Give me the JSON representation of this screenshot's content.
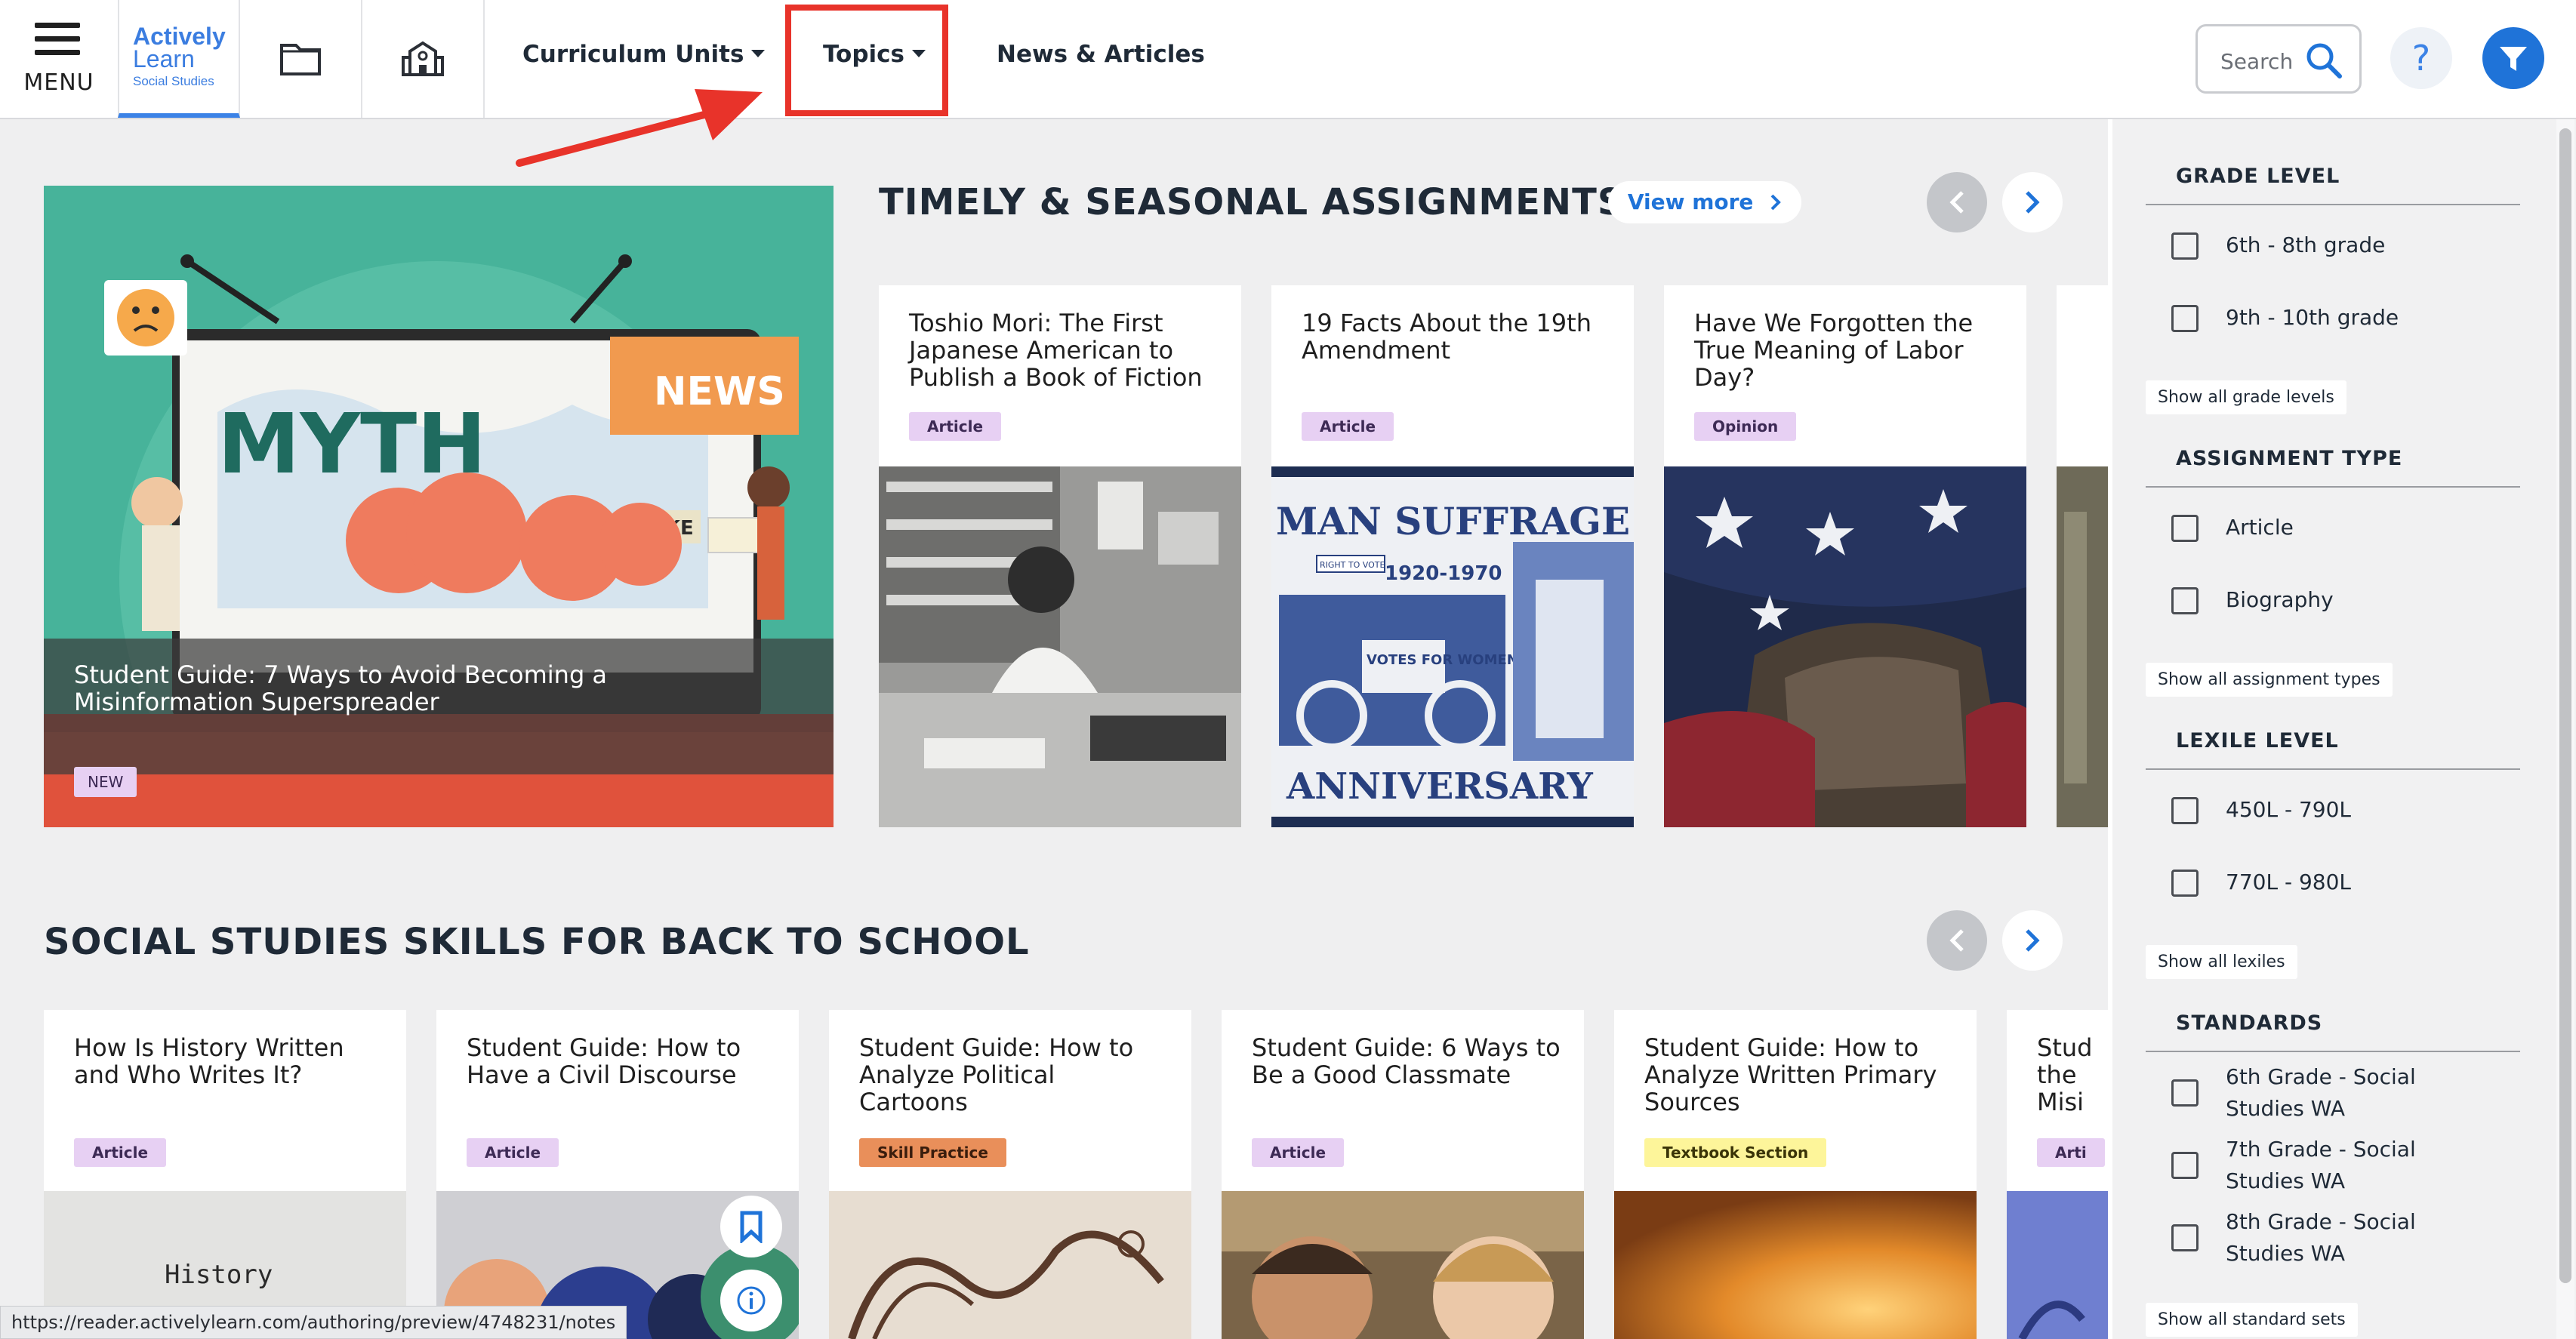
{
  "header": {
    "menu_label": "MENU",
    "logo": {
      "line1": "Actively",
      "line2": "Learn",
      "line3": "Social Studies"
    },
    "nav": {
      "curriculum": "Curriculum Units",
      "topics": "Topics",
      "news": "News & Articles"
    },
    "search_placeholder": "Search",
    "help_symbol": "?"
  },
  "icons": [
    "menu-icon",
    "book-icon",
    "school-icon",
    "search-icon",
    "help-icon",
    "filter-icon",
    "chevron-left-icon",
    "chevron-right-icon",
    "bookmark-icon",
    "info-icon"
  ],
  "colors": {
    "accent": "#1f73d8",
    "highlight": "#e8332a",
    "hero_bg": "#47b39a"
  },
  "hero": {
    "title": "Student Guide: 7 Ways to Avoid Becoming a Misinformation Superspreader",
    "badge": "NEW",
    "art_words": {
      "myth": "MYTH",
      "news": "NEWS",
      "fake": "FAKE"
    }
  },
  "timely": {
    "title": "TIMELY & SEASONAL ASSIGNMENTS",
    "view_more": "View more",
    "cards": [
      {
        "title": "Toshio Mori: The First Japanese American to Publish a Book of Fiction",
        "badge": "Article"
      },
      {
        "title": "19 Facts About the 19th Amendment",
        "badge": "Article",
        "stamp_top": "MAN SUFFRAGE",
        "stamp_years": "1920-1970",
        "stamp_bottom": "ANNIVERSARY",
        "stamp_sign": "VOTES FOR WOMEN",
        "stamp_sign2": "RIGHT TO VOTE"
      },
      {
        "title": "Have We Forgotten the True Meaning of Labor Day?",
        "badge": "Opinion"
      }
    ]
  },
  "skills": {
    "title": "SOCIAL STUDIES SKILLS FOR BACK TO SCHOOL",
    "cards": [
      {
        "title": "How Is History Written and Who Writes It?",
        "badge": "Article",
        "img_word": "History"
      },
      {
        "title": "Student Guide: How to Have a Civil Discourse",
        "badge": "Article"
      },
      {
        "title": "Student Guide: How to Analyze Political Cartoons",
        "badge": "Skill Practice"
      },
      {
        "title": "Student Guide: 6 Ways to Be a Good Classmate",
        "badge": "Article"
      },
      {
        "title": "Student Guide: How to Analyze Written Primary Sources",
        "badge": "Textbook Section"
      },
      {
        "title": "Stud the Misi",
        "badge": "Arti"
      }
    ]
  },
  "status_url": "https://reader.activelylearn.com/authoring/preview/4748231/notes",
  "sidebar": {
    "grade": {
      "heading": "GRADE LEVEL",
      "options": [
        "6th - 8th grade",
        "9th - 10th grade"
      ],
      "show_all": "Show all grade levels"
    },
    "type": {
      "heading": "ASSIGNMENT TYPE",
      "options": [
        "Article",
        "Biography"
      ],
      "show_all": "Show all assignment types"
    },
    "lexile": {
      "heading": "LEXILE LEVEL",
      "options": [
        "450L - 790L",
        "770L - 980L"
      ],
      "show_all": "Show all lexiles"
    },
    "standards": {
      "heading": "STANDARDS",
      "options": [
        {
          "line1": "6th Grade - Social",
          "line2": "Studies WA"
        },
        {
          "line1": "7th Grade - Social",
          "line2": "Studies WA"
        },
        {
          "line1": "8th Grade - Social",
          "line2": "Studies WA"
        }
      ],
      "show_all": "Show all standard sets"
    }
  }
}
